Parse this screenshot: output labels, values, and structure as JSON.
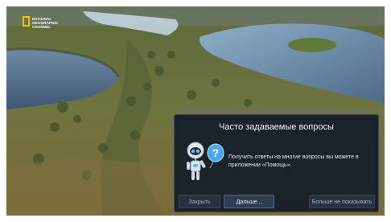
{
  "channel_logo": {
    "text": "NATIONAL\nGEOGRAPHIC\nCHANNEL",
    "frame_color": "#f2c200"
  },
  "dialog": {
    "title": "Часто задаваемые вопросы",
    "message": "Получить ответы на многие вопросы вы можете в приложении «Помощь».",
    "icon": "robot-help-icon",
    "buttons": {
      "close": "Закрыть",
      "more": "Дальше...",
      "dont_show": "Больше не показывать"
    }
  },
  "colors": {
    "dialog_background": "#161c28",
    "water": "#5f7fa0",
    "accent": "#2a88e0"
  }
}
